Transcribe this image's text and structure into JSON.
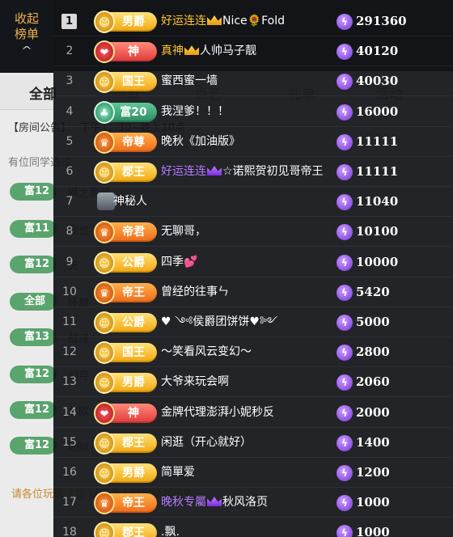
{
  "collapse": {
    "line1": "收起",
    "line2": "榜单"
  },
  "background": {
    "tabs": [
      "全部",
      "点歌",
      "点艺",
      "礼单",
      "活动"
    ],
    "announcement": "【房间公告】：  下午1：30~晚上10点",
    "line2": "有位同学通过",
    "chat": [
      {
        "badge": "富12",
        "text": "枫之翡翠"
      },
      {
        "badge": "富11",
        "text": "我也"
      },
      {
        "badge": "富12",
        "text": "天"
      },
      {
        "badge": "全部",
        "text": "怀然"
      },
      {
        "badge": "富13",
        "text": "战魂"
      },
      {
        "badge": "富12",
        "text": "幻月"
      },
      {
        "badge": "富12",
        "text": "北欧"
      },
      {
        "badge": "富12",
        "text": "地狱"
      }
    ],
    "notice": "请各位玩家注意   以免个人财产受到损失。"
  },
  "ranking": [
    {
      "rank": "1",
      "title": "男爵",
      "tier": "gold",
      "emblem": "☺",
      "prefix": "好运连连",
      "prefix_color": "yellow",
      "crown": "gold",
      "name": "Nice🌻Fold",
      "amount": "291360"
    },
    {
      "rank": "2",
      "title": "神",
      "tier": "red",
      "emblem": "❤",
      "prefix": "真神",
      "prefix_color": "yellow",
      "crown": "gold",
      "name": "人帅马子靓",
      "amount": "40120"
    },
    {
      "rank": "3",
      "title": "国王",
      "tier": "gold",
      "emblem": "☺",
      "prefix": "",
      "prefix_color": "",
      "crown": "",
      "name": "蜜西蜜一墙",
      "amount": "40030"
    },
    {
      "rank": "4",
      "title": "富20",
      "tier": "green",
      "emblem": "♣",
      "prefix": "",
      "prefix_color": "",
      "crown": "",
      "name": "我涅爹！！！",
      "amount": "16000"
    },
    {
      "rank": "5",
      "title": "帝尊",
      "tier": "orange",
      "emblem": "♛",
      "prefix": "",
      "prefix_color": "",
      "crown": "",
      "name": "晚秋《加油版》",
      "amount": "11111"
    },
    {
      "rank": "6",
      "title": "郡王",
      "tier": "gold",
      "emblem": "☺",
      "prefix": "好运连连",
      "prefix_color": "purple",
      "crown": "purple",
      "name": "☆诺熙贺初见哥帝王",
      "amount": "11111"
    },
    {
      "rank": "7",
      "title": "",
      "tier": "none",
      "emblem": "",
      "prefix": "",
      "prefix_color": "",
      "crown": "",
      "name": "神秘人",
      "amount": "11040",
      "avatar": true
    },
    {
      "rank": "8",
      "title": "帝君",
      "tier": "orange",
      "emblem": "♛",
      "prefix": "",
      "prefix_color": "",
      "crown": "",
      "name": "无聊哥，",
      "amount": "10100"
    },
    {
      "rank": "9",
      "title": "公爵",
      "tier": "gold",
      "emblem": "☺",
      "prefix": "",
      "prefix_color": "",
      "crown": "",
      "name": "四季💕",
      "amount": "10000"
    },
    {
      "rank": "10",
      "title": "帝王",
      "tier": "orange",
      "emblem": "♛",
      "prefix": "",
      "prefix_color": "",
      "crown": "",
      "name": "曾经的往事ㄣ",
      "amount": "5420"
    },
    {
      "rank": "11",
      "title": "公爵",
      "tier": "gold",
      "emblem": "☺",
      "prefix": "",
      "prefix_color": "",
      "crown": "",
      "name": "♥ ༺侯爵团饼饼♥༻",
      "amount": "5000"
    },
    {
      "rank": "12",
      "title": "国王",
      "tier": "gold",
      "emblem": "☺",
      "prefix": "",
      "prefix_color": "",
      "crown": "",
      "name": "～笑看风云变幻～",
      "amount": "2800"
    },
    {
      "rank": "13",
      "title": "男爵",
      "tier": "gold",
      "emblem": "☺",
      "prefix": "",
      "prefix_color": "",
      "crown": "",
      "name": "大爷来玩会啊",
      "amount": "2060"
    },
    {
      "rank": "14",
      "title": "神",
      "tier": "red",
      "emblem": "❤",
      "prefix": "",
      "prefix_color": "",
      "crown": "",
      "name": "金牌代理澎湃小妮秒反",
      "amount": "2000"
    },
    {
      "rank": "15",
      "title": "郡王",
      "tier": "gold",
      "emblem": "☺",
      "prefix": "",
      "prefix_color": "",
      "crown": "",
      "name": "闲逛（开心就好）",
      "amount": "1400"
    },
    {
      "rank": "16",
      "title": "男爵",
      "tier": "gold",
      "emblem": "☺",
      "prefix": "",
      "prefix_color": "",
      "crown": "",
      "name": "简單爱",
      "amount": "1200"
    },
    {
      "rank": "17",
      "title": "帝王",
      "tier": "orange",
      "emblem": "♛",
      "prefix": "晚秋专屬",
      "prefix_color": "purple",
      "crown": "purple",
      "name": "秋风洛页",
      "amount": "1000"
    },
    {
      "rank": "18",
      "title": "郡王",
      "tier": "gold",
      "emblem": "☺",
      "prefix": "",
      "prefix_color": "",
      "crown": "",
      "name": ".飘.",
      "amount": "1000"
    }
  ],
  "colors": {
    "panel_bg": "rgba(18,20,24,0.93)",
    "gold": "#f3a60d",
    "purple_prefix": "#b57cff",
    "yellow_prefix": "#ffc62a"
  }
}
